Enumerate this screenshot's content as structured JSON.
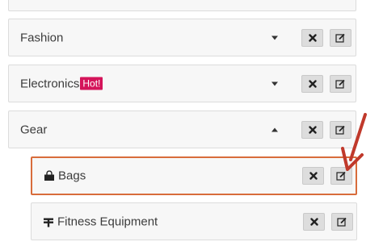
{
  "categories": [
    {
      "label": "Fashion",
      "badge": "",
      "expanded": false
    },
    {
      "label": "Electronics",
      "badge": "Hot!",
      "expanded": false
    },
    {
      "label": "Gear",
      "badge": "",
      "expanded": true
    }
  ],
  "subcategories": [
    {
      "label": "Bags",
      "icon": "shopping-bag-icon",
      "selected": true
    },
    {
      "label": "Fitness Equipment",
      "icon": "fitness-icon",
      "selected": false
    }
  ],
  "colors": {
    "badge": "#d4145a",
    "selected_border": "#d86c3b",
    "arrow": "#c0392b"
  }
}
